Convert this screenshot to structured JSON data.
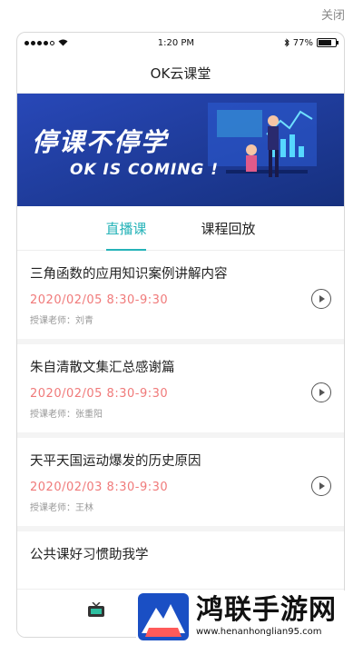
{
  "close_label": "关闭",
  "status_bar": {
    "time": "1:20 PM",
    "battery": "77%",
    "battery_level": 0.77
  },
  "nav": {
    "title": "OK云课堂"
  },
  "banner": {
    "title": "停课不停学",
    "subtitle": "OK IS COMING !"
  },
  "tabs": [
    {
      "label": "直播课",
      "active": true
    },
    {
      "label": "课程回放",
      "active": false
    }
  ],
  "lessons": [
    {
      "title": "三角函数的应用知识案例讲解内容",
      "time": "2020/02/05  8:30-9:30",
      "teacher": "授课老师：刘青"
    },
    {
      "title": "朱自清散文集汇总感谢篇",
      "time": "2020/02/05  8:30-9:30",
      "teacher": "授课老师：张重阳"
    },
    {
      "title": "天平天国运动爆发的历史原因",
      "time": "2020/02/03  8:30-9:30",
      "teacher": "授课老师：王林"
    },
    {
      "title": "公共课好习惯助我学"
    }
  ],
  "watermark": {
    "name": "鸿联手游网",
    "url": "www.henanhonglian95.com"
  },
  "colors": {
    "accent": "#25b3b8",
    "time_red": "#f07a7a",
    "banner_bg": "#1f3fa0"
  }
}
